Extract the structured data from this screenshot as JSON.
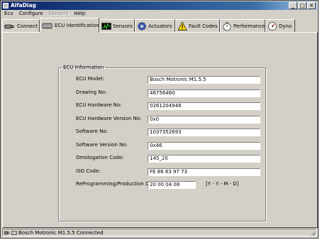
{
  "window": {
    "title": "AlfaDiag",
    "minimize": "_",
    "maximize": "□",
    "close": "✕"
  },
  "menu": [
    {
      "label": "Ecu",
      "disabled": false
    },
    {
      "label": "Configure",
      "disabled": false
    },
    {
      "label": "Sensors",
      "disabled": true
    },
    {
      "label": "Help",
      "disabled": false
    }
  ],
  "tabs": [
    {
      "label": "Connect",
      "icon": "connector-icon"
    },
    {
      "label": "ECU Identification",
      "icon": "ecu-chip-icon",
      "active": true
    },
    {
      "label": "Sensors",
      "icon": "oscilloscope-icon"
    },
    {
      "label": "Actuators",
      "icon": "gear-icon"
    },
    {
      "label": "Fault Codes",
      "icon": "warning-icon"
    },
    {
      "label": "Performance",
      "icon": "stopwatch-icon"
    },
    {
      "label": "Dyno",
      "icon": "dial-icon"
    }
  ],
  "ecu_info": {
    "legend": "ECU Information",
    "fields": [
      {
        "label": "ECU Model:",
        "value": "Bosch Motronic M1.5.5"
      },
      {
        "label": "Drawing No:",
        "value": "46756460"
      },
      {
        "label": "ECU Hardware No:",
        "value": "0261204946"
      },
      {
        "label": "ECU Hardware Version No:",
        "value": "0x0"
      },
      {
        "label": "Software No:",
        "value": "1037352693"
      },
      {
        "label": "Software Version No:",
        "value": "0x46"
      },
      {
        "label": "Omologation Code:",
        "value": "145_20"
      },
      {
        "label": "ISO Code:",
        "value": "FE 86 83 97 73"
      },
      {
        "label": "ReProgramming/Production Date:",
        "value": "20 00 04 08"
      }
    ],
    "date_format": "[Y - Y - M - D]"
  },
  "status": {
    "text": "Bosch Motronic M1.5.5 Connected",
    "icon": "connected-plug-icon"
  }
}
